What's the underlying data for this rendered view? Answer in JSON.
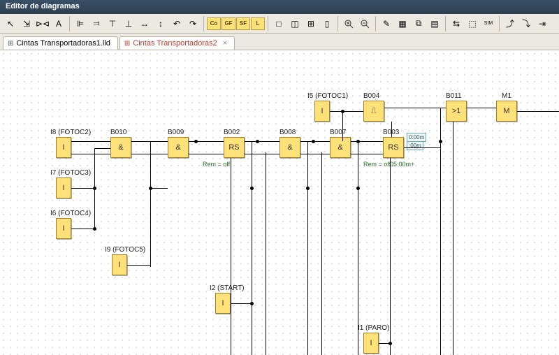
{
  "window": {
    "title": "Editor de diagramas"
  },
  "toolbar": {
    "arrow": "↖",
    "link1": "⇲",
    "link2": "⊳⊲",
    "text": "A",
    "alignL": "⊫",
    "alignR": "⫤",
    "alignT": "⊤",
    "alignB": "⊥",
    "distH": "↔",
    "distV": "↕",
    "rot1": "↶",
    "rot2": "↷",
    "co": "Co",
    "gf": "GF",
    "sf": "SF",
    "l": "L",
    "pane1": "□",
    "pane2": "◫",
    "pane3": "⊞",
    "pane4": "▯",
    "zoomIn": "+",
    "zoomOut": "−",
    "t1": "✎",
    "t2": "▦",
    "t3": "⧉",
    "t4": "▤",
    "t5": "⇆",
    "t6": "⬚",
    "t7": "SIM",
    "t8": "⤴",
    "t9": "⤵",
    "t10": "⇥"
  },
  "tabs": {
    "tab1": {
      "icon": "⊞",
      "label": "Cintas Transportadoras1.lld"
    },
    "tab2": {
      "icon": "⊞",
      "label": "Cintas Transportadoras2",
      "close": "×"
    }
  },
  "blocks": {
    "i5": {
      "label": "I5 (FOTOC1)",
      "text": "I"
    },
    "b004": {
      "label": "B004",
      "text": "⎍"
    },
    "b011": {
      "label": "B011",
      "text": ">1"
    },
    "m1": {
      "label": "M1",
      "text": "M"
    },
    "i8": {
      "label": "I8 (FOTOC2)",
      "text": "I"
    },
    "b010": {
      "label": "B010",
      "text": "&"
    },
    "b009": {
      "label": "B009",
      "text": "&"
    },
    "b002": {
      "label": "B002",
      "text": "RS"
    },
    "b008": {
      "label": "B008",
      "text": "&"
    },
    "b007": {
      "label": "B007",
      "text": "&"
    },
    "b003": {
      "label": "B003",
      "text": "RS"
    },
    "i7": {
      "label": "I7 (FOTOC3)",
      "text": "I"
    },
    "i6": {
      "label": "I6 (FOTOC4)",
      "text": "I"
    },
    "i9": {
      "label": "I9 (FOTOC5)",
      "text": "I"
    },
    "i2": {
      "label": "I2 (START)",
      "text": "I"
    },
    "i1": {
      "label": "I1 (PARO)",
      "text": "I"
    }
  },
  "notes": {
    "rem1": "Rem = off",
    "rem2": "Rem = off",
    "t1": "0:00m",
    "t2": ":00m",
    "t3": "05:00m+"
  }
}
